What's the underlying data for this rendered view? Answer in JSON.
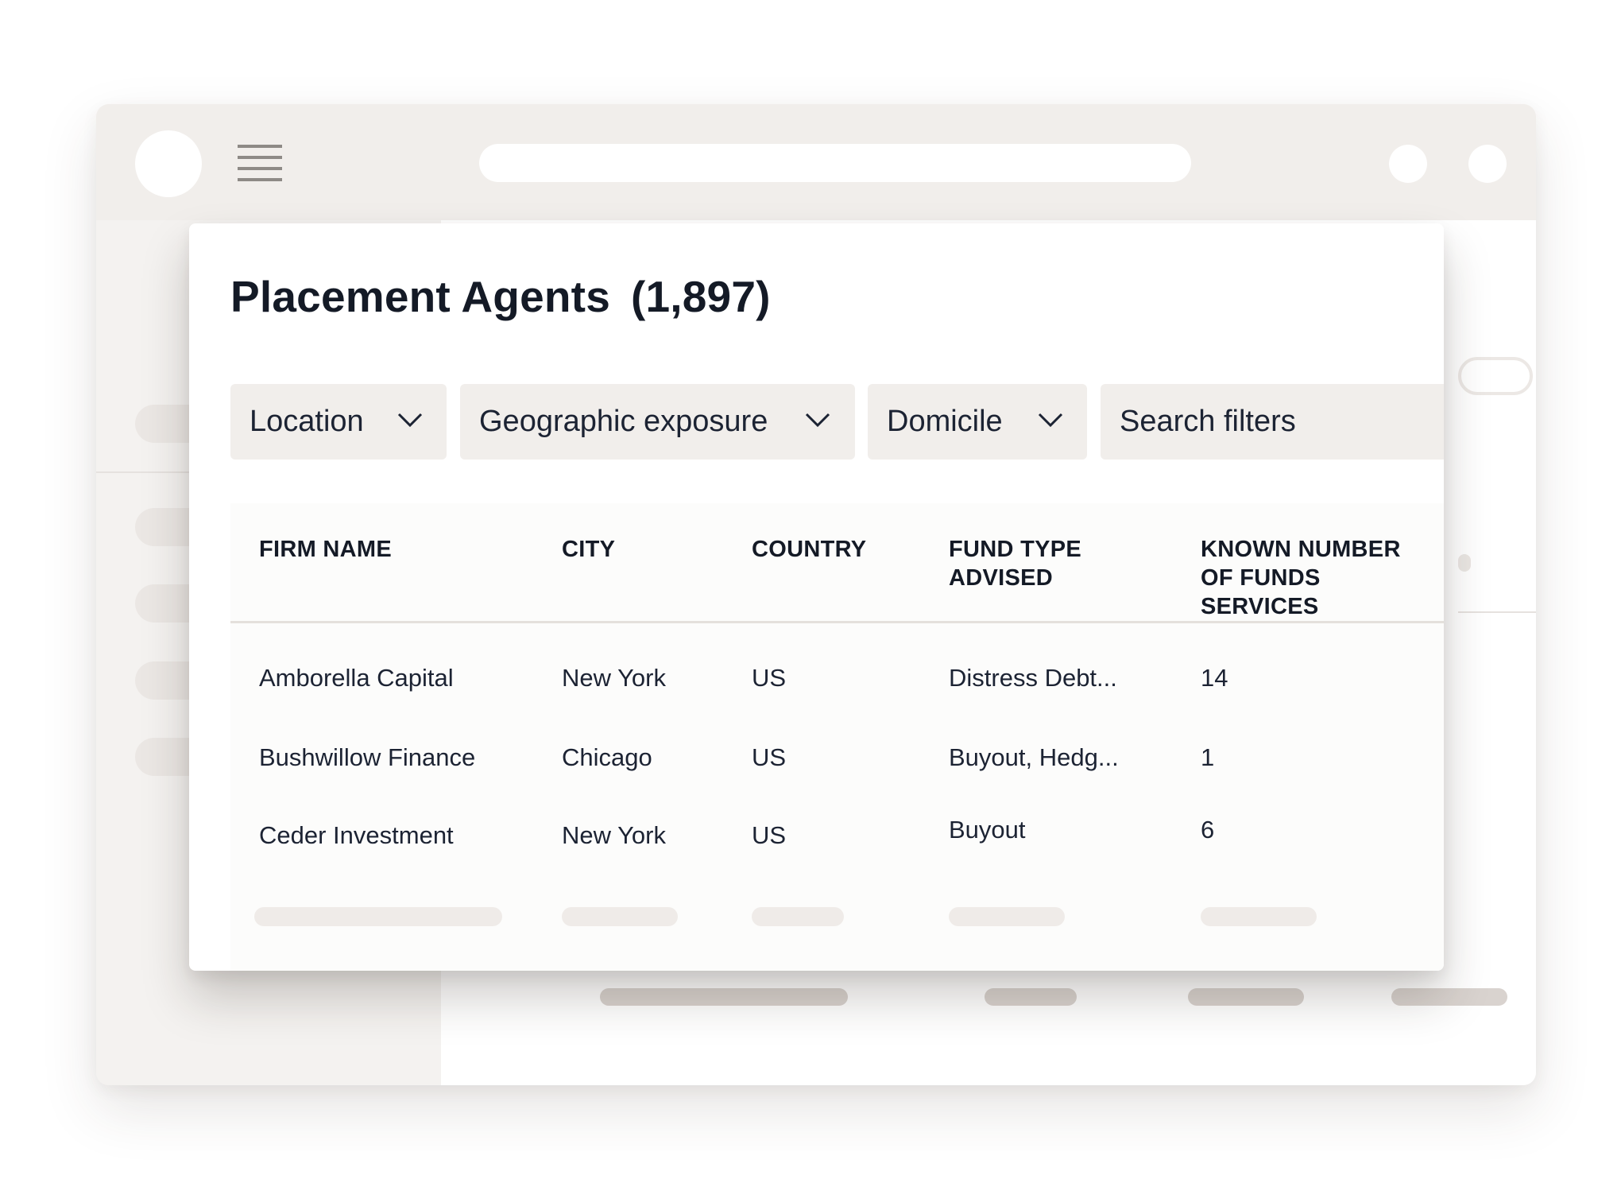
{
  "card": {
    "title": "Placement Agents",
    "count": "(1,897)"
  },
  "filters": {
    "location": "Location",
    "geographic": "Geographic exposure",
    "domicile": "Domicile",
    "search_placeholder": "Search filters"
  },
  "table": {
    "columns": [
      "FIRM NAME",
      "CITY",
      "COUNTRY",
      "FUND TYPE\nADVISED",
      "KNOWN NUMBER\nOF FUNDS SERVICES"
    ],
    "rows": [
      {
        "firm": "Amborella Capital",
        "city": "New York",
        "country": "US",
        "fund_type": "Distress Debt...",
        "funds": "14"
      },
      {
        "firm": "Bushwillow Finance",
        "city": "Chicago",
        "country": "US",
        "fund_type": "Buyout, Hedg...",
        "funds": "1"
      },
      {
        "firm": "Ceder Investment",
        "city": "New York",
        "country": "US",
        "fund_type": "Buyout",
        "funds": "6"
      }
    ]
  },
  "icons": {
    "menu": "hamburger-menu-icon",
    "dropdown": "chevron-down-icon"
  },
  "colors": {
    "title": "#141a26",
    "filter_bg": "#f1eeeb",
    "chrome_bg": "#f1eeeb"
  }
}
